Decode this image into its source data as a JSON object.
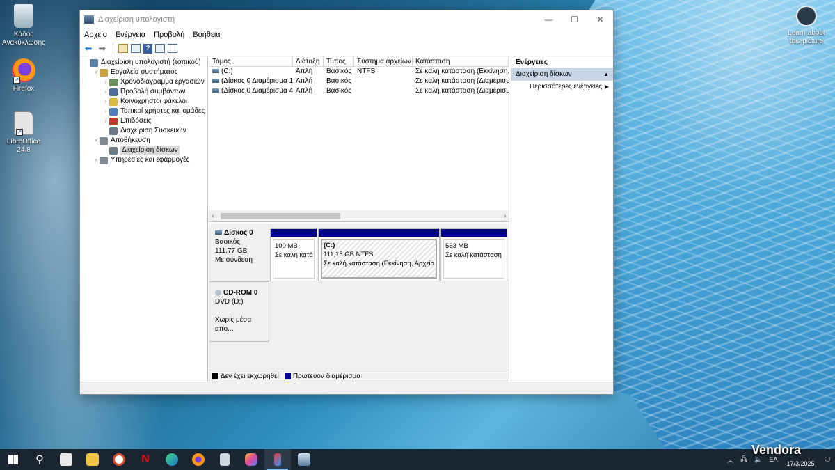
{
  "desktop": {
    "icons": [
      {
        "label": "Κάδος Ανακύκλωσης"
      },
      {
        "label": "Firefox"
      },
      {
        "label": "LibreOffice 24.8"
      }
    ],
    "spotlight_label": "Learn about this picture"
  },
  "window": {
    "title": "Διαχείριση υπολογιστή",
    "controls": {
      "minimize": "—",
      "maximize": "☐",
      "close": "✕"
    },
    "menu": [
      "Αρχείο",
      "Ενέργεια",
      "Προβολή",
      "Βοήθεια"
    ],
    "tree": [
      {
        "label": "Διαχείριση υπολογιστή (τοπικού)",
        "level": 0,
        "expander": "",
        "icon_color": "#5b7fa3"
      },
      {
        "label": "Εργαλεία συστήματος",
        "level": 1,
        "expander": "˅",
        "icon_color": "#c9a040"
      },
      {
        "label": "Χρονοδιάγραμμα εργασιών",
        "level": 2,
        "expander": "›",
        "icon_color": "#6b8e5a"
      },
      {
        "label": "Προβολή συμβάντων",
        "level": 2,
        "expander": "›",
        "icon_color": "#4a6f9c"
      },
      {
        "label": "Κοινόχρηστοι φάκελοι",
        "level": 2,
        "expander": "›",
        "icon_color": "#d9b84a"
      },
      {
        "label": "Τοπικοί χρήστες και ομάδες",
        "level": 2,
        "expander": "›",
        "icon_color": "#4f7fb8"
      },
      {
        "label": "Επιδόσεις",
        "level": 2,
        "expander": "›",
        "icon_color": "#c0392b"
      },
      {
        "label": "Διαχείριση Συσκευών",
        "level": 2,
        "expander": "",
        "icon_color": "#6d7b89"
      },
      {
        "label": "Αποθήκευση",
        "level": 1,
        "expander": "˅",
        "icon_color": "#7d8a96"
      },
      {
        "label": "Διαχείριση δίσκων",
        "level": 2,
        "expander": "",
        "icon_color": "#6d7b89",
        "selected": true
      },
      {
        "label": "Υπηρεσίες και εφαρμογές",
        "level": 1,
        "expander": "›",
        "icon_color": "#7d8a96"
      }
    ],
    "volumes": {
      "columns": [
        "Τόμος",
        "Διάταξη",
        "Τύπος",
        "Σύστημα αρχείων",
        "Κατάσταση"
      ],
      "rows": [
        [
          "(C:)",
          "Απλή",
          "Βασικός",
          "NTFS",
          "Σε καλή κατάσταση (Εκκίνηση,"
        ],
        [
          "(Δίσκος 0 Διαμέρισμα 1)",
          "Απλή",
          "Βασικός",
          "",
          "Σε καλή κατάσταση (Διαμέρισμ"
        ],
        [
          "(Δίσκος 0 Διαμέρισμα 4)",
          "Απλή",
          "Βασικός",
          "",
          "Σε καλή κατάσταση (Διαμέρισμ"
        ]
      ]
    },
    "disks": [
      {
        "name": "Δίσκος 0",
        "type": "Βασικός",
        "size": "111,77 GB",
        "status": "Με σύνδεση",
        "partitions": [
          {
            "title": "",
            "size": "100 MB",
            "status": "Σε καλή κατά"
          },
          {
            "title": "(C:)",
            "size": "111,15 GB NTFS",
            "status": "Σε καλή κατάσταση (Εκκίνηση, Αρχείο"
          },
          {
            "title": "",
            "size": "533 MB",
            "status": "Σε καλή κατάσταση"
          }
        ]
      },
      {
        "name": "CD-ROM 0",
        "type": "DVD (D:)",
        "status": "Χωρίς μέσα απο..."
      }
    ],
    "legend": [
      {
        "label": "Δεν έχει εκχωρηθεί",
        "color": "#000000"
      },
      {
        "label": "Πρωτεύον διαμέρισμα",
        "color": "#00008b"
      }
    ],
    "actions": {
      "header": "Ενέργειες",
      "group": "Διαχείριση δίσκων",
      "item": "Περισσότερες ενέργειες"
    }
  },
  "taskbar": {
    "tray": {
      "language": "ΕΛ",
      "date": "17/3/2025"
    }
  },
  "watermark": "Vendora"
}
